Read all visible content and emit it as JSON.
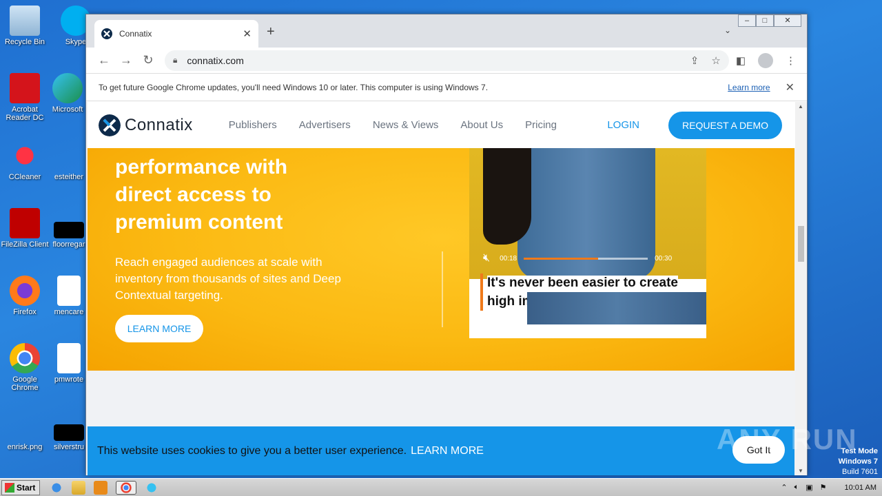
{
  "desktop": {
    "icons": [
      {
        "label": "Recycle Bin"
      },
      {
        "label": "Skype"
      },
      {
        "label": "Acrobat Reader DC"
      },
      {
        "label": "Microsoft"
      },
      {
        "label": "CCleaner"
      },
      {
        "label": "esteither"
      },
      {
        "label": "FileZilla Client"
      },
      {
        "label": "floorregar"
      },
      {
        "label": "Firefox"
      },
      {
        "label": "mencare"
      },
      {
        "label": "Google Chrome"
      },
      {
        "label": "pmwrote"
      },
      {
        "label": "enrisk.png"
      },
      {
        "label": "silverstru"
      }
    ]
  },
  "browser": {
    "tab_title": "Connatix",
    "url": "connatix.com",
    "infobar_text": "To get future Google Chrome updates, you'll need Windows 10 or later. This computer is using Windows 7.",
    "infobar_link": "Learn more"
  },
  "site": {
    "brand": "Connatix",
    "nav": [
      "Publishers",
      "Advertisers",
      "News & Views",
      "About Us",
      "Pricing"
    ],
    "login": "LOGIN",
    "demo": "REQUEST A DEMO",
    "hero_title": "performance with direct access to premium content",
    "hero_text": "Reach engaged audiences at scale with inventory from thousands of sites and Deep Contextual targeting.",
    "hero_button": "LEARN MORE",
    "video": {
      "time_current": "00:18",
      "time_total": "00:30",
      "progress": 0.6,
      "caption": "It's never been easier to create high impact video exp..."
    },
    "cookie_text": "This website uses cookies to give you a better user experience.",
    "cookie_link": "LEARN MORE",
    "cookie_button": "Got It"
  },
  "watermark": "ANY RUN",
  "system": {
    "test_mode": "Test Mode",
    "os": "Windows 7",
    "build": "Build 7601",
    "start": "Start",
    "clock": "10:01 AM"
  },
  "colors": {
    "accent": "#1595e8",
    "hero": "#fbb912",
    "progress": "#f07a1a"
  }
}
